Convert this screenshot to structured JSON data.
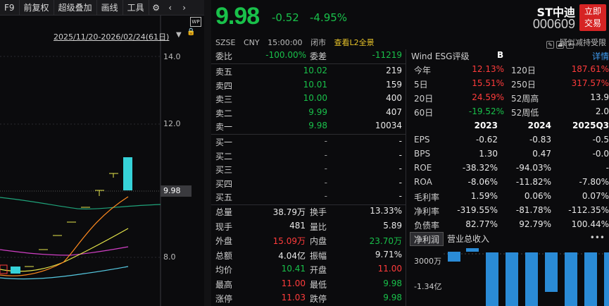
{
  "toolbar": {
    "items": [
      "F9",
      "前复权",
      "超级叠加",
      "画线",
      "工具"
    ],
    "icons": [
      "gear-icon",
      "chevron-left-icon",
      "chevron-right-icon"
    ]
  },
  "chart": {
    "date_range": "2025/11/20-2026/02/24(61日)",
    "price_ticks": [
      "14.0",
      "12.0",
      "9.98",
      "8.0"
    ],
    "current_price_tag": "9.98",
    "badge": "WP"
  },
  "quote": {
    "last_price": "9.98",
    "change": "-0.52",
    "change_pct": "-4.95%",
    "exchange": "SZSE",
    "currency": "CNY",
    "time": "15:00:00",
    "status": "闭市",
    "l2_link": "查看L2全景",
    "name": "ST中迪",
    "code": "000609",
    "trade_button": [
      "立即",
      "交易"
    ],
    "tags": "疑似减持受限"
  },
  "order_book": {
    "ratio_label": "委比",
    "ratio_value": "-100.00%",
    "diff_label": "委差",
    "diff_value": "-11219",
    "asks": [
      {
        "label": "卖五",
        "price": "10.02",
        "vol": "219"
      },
      {
        "label": "卖四",
        "price": "10.01",
        "vol": "159"
      },
      {
        "label": "卖三",
        "price": "10.00",
        "vol": "400"
      },
      {
        "label": "卖二",
        "price": "9.99",
        "vol": "407"
      },
      {
        "label": "卖一",
        "price": "9.98",
        "vol": "10034"
      }
    ],
    "bids": [
      {
        "label": "买一",
        "price": "-",
        "vol": "-"
      },
      {
        "label": "买二",
        "price": "-",
        "vol": "-"
      },
      {
        "label": "买三",
        "price": "-",
        "vol": "-"
      },
      {
        "label": "买四",
        "price": "-",
        "vol": "-"
      },
      {
        "label": "买五",
        "price": "-",
        "vol": "-"
      }
    ]
  },
  "stats": [
    {
      "l1": "总量",
      "v1": "38.79万",
      "l2": "换手",
      "v2": "13.33%"
    },
    {
      "l1": "现手",
      "v1": "481",
      "l2": "量比",
      "v2": "5.89"
    },
    {
      "l1": "外盘",
      "v1": "15.09万",
      "l2": "内盘",
      "v2": "23.70万"
    },
    {
      "l1": "总额",
      "v1": "4.04亿",
      "l2": "振幅",
      "v2": "9.71%"
    },
    {
      "l1": "均价",
      "v1": "10.41",
      "l2": "开盘",
      "v2": "11.00"
    },
    {
      "l1": "最高",
      "v1": "11.00",
      "l2": "最低",
      "v2": "9.98"
    },
    {
      "l1": "涨停",
      "v1": "11.03",
      "l2": "跌停",
      "v2": "9.98"
    }
  ],
  "fin": {
    "esg_label": "Wind ESG评级",
    "esg_grade": "B",
    "detail": "详情",
    "returns": [
      {
        "l1": "今年",
        "v1": "12.13%",
        "l2": "120日",
        "v2": "187.61%"
      },
      {
        "l1": "5日",
        "v1": "15.51%",
        "l2": "250日",
        "v2": "317.57%"
      },
      {
        "l1": "20日",
        "v1": "24.59%",
        "l2": "52周高",
        "v2": "13.9"
      },
      {
        "l1": "60日",
        "v1": "-19.52%",
        "l2": "52周低",
        "v2": "2.0"
      }
    ],
    "years": [
      "2023",
      "2024",
      "2025Q3"
    ],
    "metrics": [
      {
        "name": "EPS",
        "vals": [
          "-0.62",
          "-0.83",
          "-0.5"
        ]
      },
      {
        "name": "BPS",
        "vals": [
          "1.30",
          "0.47",
          "-0.0"
        ]
      },
      {
        "name": "ROE",
        "vals": [
          "-38.32%",
          "-94.03%",
          "-"
        ]
      },
      {
        "name": "ROA",
        "vals": [
          "-8.06%",
          "-11.82%",
          "-7.80%"
        ]
      },
      {
        "name": "毛利率",
        "vals": [
          "1.59%",
          "0.06%",
          "0.07%"
        ]
      },
      {
        "name": "净利率",
        "vals": [
          "-319.55%",
          "-81.78%",
          "-112.35%"
        ]
      },
      {
        "name": "负债率",
        "vals": [
          "82.77%",
          "92.79%",
          "100.44%"
        ]
      }
    ],
    "tabs": [
      "净利润",
      "营业总收入"
    ],
    "more": "•••",
    "bar_axis": [
      "3000万",
      "-1.34亿"
    ]
  }
}
